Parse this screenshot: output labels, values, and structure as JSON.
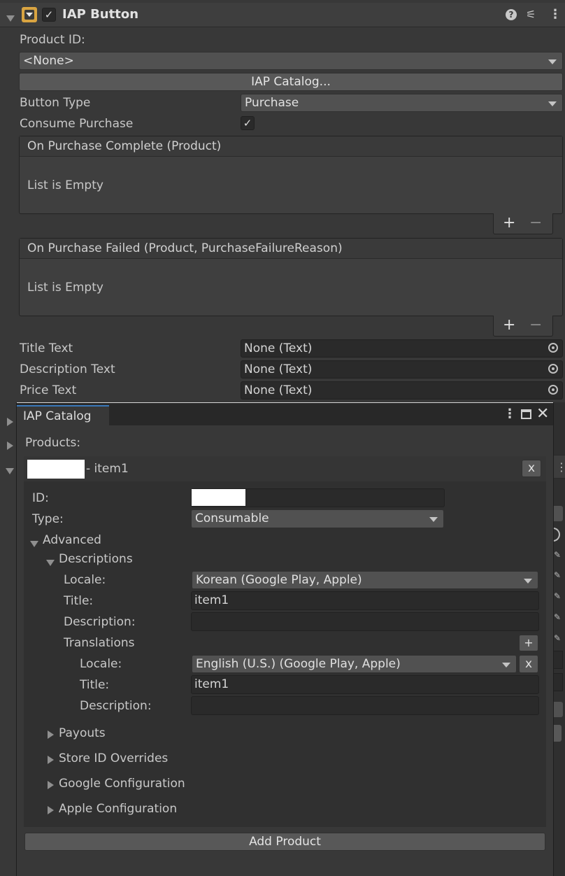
{
  "component": {
    "title": "IAP Button",
    "product_id_label": "Product ID:",
    "product_id_value": "<None>",
    "catalog_button": "IAP Catalog...",
    "button_type_label": "Button Type",
    "button_type_value": "Purchase",
    "consume_label": "Consume Purchase",
    "consume_checked": true,
    "on_complete_header": "On Purchase Complete (Product)",
    "on_complete_empty": "List is Empty",
    "on_failed_header": "On Purchase Failed (Product, PurchaseFailureReason)",
    "on_failed_empty": "List is Empty",
    "title_text_label": "Title Text",
    "title_text_value": "None (Text)",
    "description_text_label": "Description Text",
    "description_text_value": "None (Text)",
    "price_text_label": "Price Text",
    "price_text_value": "None (Text)",
    "plus": "+",
    "minus": "−"
  },
  "catalog": {
    "tab_title": "IAP Catalog",
    "products_label": "Products:",
    "product_header_suffix": "- item1",
    "remove_label": "x",
    "id_label": "ID:",
    "type_label": "Type:",
    "type_value": "Consumable",
    "advanced_label": "Advanced",
    "descriptions_label": "Descriptions",
    "locale_label": "Locale:",
    "locale_value": "Korean (Google Play, Apple)",
    "title_label": "Title:",
    "title_value": "item1",
    "description_label": "Description:",
    "description_value": "",
    "translations_label": "Translations",
    "add_translation": "+",
    "translation": {
      "locale_label": "Locale:",
      "locale_value": "English (U.S.) (Google Play, Apple)",
      "remove_label": "x",
      "title_label": "Title:",
      "title_value": "item1",
      "description_label": "Description:",
      "description_value": ""
    },
    "sections": [
      "Payouts",
      "Store ID Overrides",
      "Google Configuration",
      "Apple Configuration"
    ],
    "add_product_button": "Add Product"
  }
}
